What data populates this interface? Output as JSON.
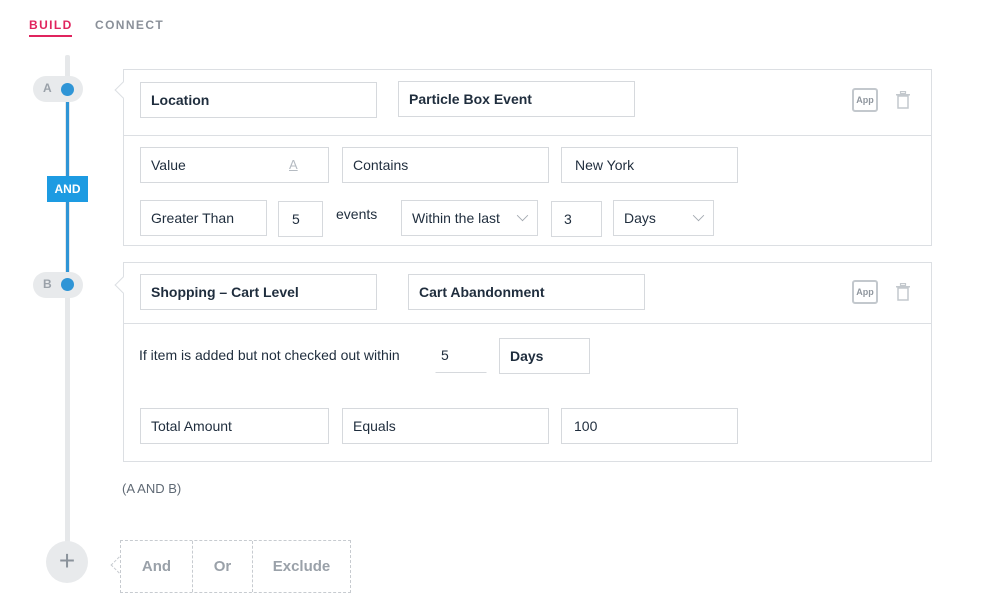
{
  "tabs": {
    "build": "BUILD",
    "connect": "CONNECT"
  },
  "timeline": {
    "node_a": "A",
    "node_b": "B",
    "and_badge": "AND"
  },
  "accent_colors": {
    "active_tab": "#e0245e",
    "timeline": "#2f95d6",
    "and_badge": "#1d9be2"
  },
  "block_a": {
    "category": "Location",
    "event": "Particle Box Event",
    "app_badge": "App",
    "row1": {
      "attribute": "Value",
      "operator": "Contains",
      "value": "New York"
    },
    "row2": {
      "comparator": "Greater Than",
      "count": "5",
      "events_label": "events",
      "window": "Within the last",
      "window_value": "3",
      "unit": "Days"
    }
  },
  "block_b": {
    "category": "Shopping – Cart Level",
    "event": "Cart Abandonment",
    "app_badge": "App",
    "row1": {
      "text": "If item is added but not checked out within",
      "value": "5",
      "unit": "Days"
    },
    "row2": {
      "attribute": "Total Amount",
      "operator": "Equals",
      "value": "100"
    }
  },
  "expression": "(A AND B)",
  "add_icon": "+",
  "operators": [
    "And",
    "Or",
    "Exclude"
  ]
}
